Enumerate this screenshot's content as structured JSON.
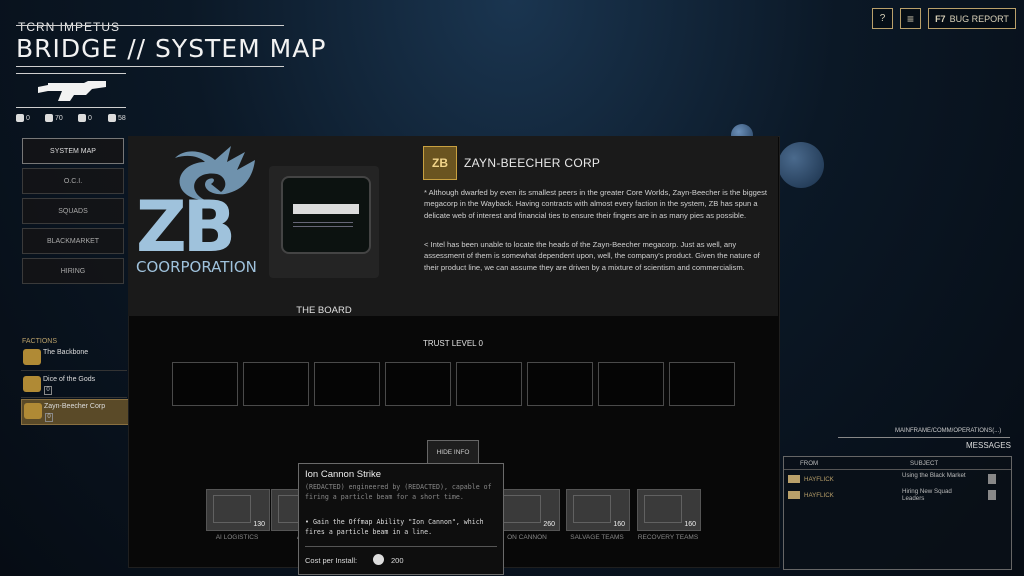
{
  "header": {
    "ship": "TCRN IMPETUS",
    "title": "BRIDGE // SYSTEM MAP"
  },
  "topbar": {
    "help": "?",
    "menu": "≡",
    "bug_key": "F7",
    "bug_label": "BUG REPORT"
  },
  "resources": [
    {
      "icon": "personnel-icon",
      "value": "0"
    },
    {
      "icon": "hand-icon",
      "value": "70"
    },
    {
      "icon": "gear-icon",
      "value": "0"
    },
    {
      "icon": "chip-icon",
      "value": "58"
    }
  ],
  "nav": [
    {
      "label": "SYSTEM MAP",
      "active": true
    },
    {
      "label": "O.C.I."
    },
    {
      "label": "SQUADS"
    },
    {
      "label": "BLACKMARKET"
    },
    {
      "label": "HIRING"
    }
  ],
  "factions": {
    "heading": "FACTIONS",
    "items": [
      {
        "name": "The Backbone",
        "count": ""
      },
      {
        "name": "Dice of the Gods",
        "count": "0"
      },
      {
        "name": "Zayn-Beecher Corp",
        "count": "0"
      }
    ]
  },
  "corp": {
    "logo_letters": "ZB",
    "logo_word": "COORPORATION",
    "monitor_label": "THE BOARD",
    "badge": "ZB",
    "name": "ZAYN-BEECHER CORP",
    "desc1": "* Although dwarfed by even its smallest peers in the greater Core Worlds, Zayn-Beecher is the biggest megacorp in the Wayback. Having contracts with almost every faction in the system, ZB has spun a delicate web of interest and financial ties to ensure their fingers are in as many pies as possible.",
    "desc2": "< Intel has been unable to locate the heads of the Zayn-Beecher megacorp. Just as well, any assessment of them is somewhat dependent upon, well, the company's product. Given the nature of their product line, we can assume they are driven by a mixture of scientism and commercialism."
  },
  "trust": {
    "label": "TRUST LEVEL 0"
  },
  "hide_info": "HIDE INFO",
  "cards": [
    {
      "label": "AI LOGISTICS",
      "cost": "130"
    },
    {
      "label": "AI",
      "cost": ""
    },
    {
      "label": "",
      "cost": ""
    },
    {
      "label": "",
      "cost": ""
    },
    {
      "label": "ON CANNON",
      "cost": "260"
    },
    {
      "label": "SALVAGE TEAMS",
      "cost": "160"
    },
    {
      "label": "RECOVERY TEAMS",
      "cost": "160"
    }
  ],
  "tooltip": {
    "title": "Ion Cannon Strike",
    "desc": "(REDACTED) engineered by (REDACTED), capable of firing a particle beam for a short time.",
    "effect": "• Gain the Offmap Ability \"Ion Cannon\", which fires a particle beam in a line.",
    "cost_label": "Cost per Install:",
    "cost_value": "200"
  },
  "messages": {
    "path": "MAINFRAME/COMM/OPERATIONS(...)",
    "title": "MESSAGES",
    "col_from": "FROM",
    "col_subject": "SUBJECT",
    "rows": [
      {
        "from": "HAYFLICK",
        "subject": "Using the Black Market"
      },
      {
        "from": "HAYFLICK",
        "subject": "Hiring New Squad Leaders"
      }
    ]
  },
  "colors": {
    "accent": "#b9a06a",
    "gold": "#c8a040"
  }
}
